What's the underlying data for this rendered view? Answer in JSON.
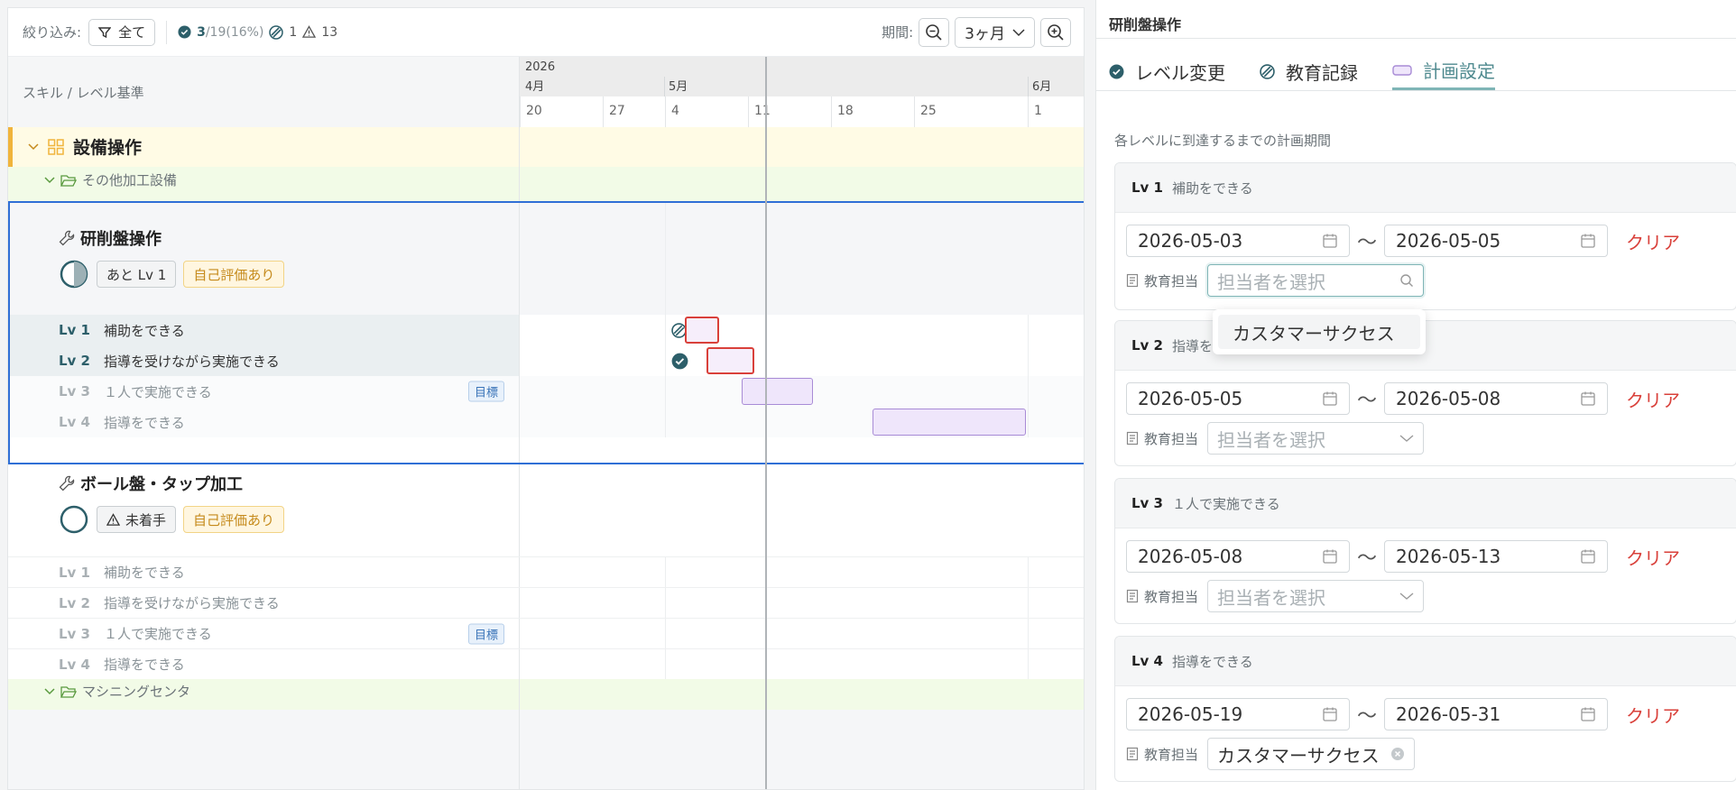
{
  "toolbar": {
    "filter_label": "絞り込み:",
    "filter_value": "全て",
    "stat_done": "3",
    "stat_total": "/19",
    "stat_pct": "(16%)",
    "stat_edu": "1",
    "stat_warn": "13",
    "period_label": "期間:",
    "period_value": "3ヶ月"
  },
  "timeline": {
    "column_header": "スキル / レベル基準",
    "year": "2026",
    "months": [
      "4月",
      "5月",
      "6月"
    ],
    "days": [
      "20",
      "27",
      "4",
      "11",
      "18",
      "25",
      "1"
    ]
  },
  "category": {
    "name": "設備操作"
  },
  "groups": [
    {
      "name": "その他加工設備"
    },
    {
      "name": "マシニングセンタ"
    }
  ],
  "skills": [
    {
      "name": "研削盤操作",
      "tag1": "あと Lv 1",
      "tag2": "自己評価あり",
      "levels": [
        {
          "lv": "Lv 1",
          "desc": "補助をできる"
        },
        {
          "lv": "Lv 2",
          "desc": "指導を受けながら実施できる"
        },
        {
          "lv": "Lv 3",
          "desc": "１人で実施できる",
          "goal": "目標"
        },
        {
          "lv": "Lv 4",
          "desc": "指導をできる"
        }
      ]
    },
    {
      "name": "ボール盤・タップ加工",
      "tag1": "未着手",
      "tag2": "自己評価あり",
      "levels": [
        {
          "lv": "Lv 1",
          "desc": "補助をできる"
        },
        {
          "lv": "Lv 2",
          "desc": "指導を受けながら実施できる"
        },
        {
          "lv": "Lv 3",
          "desc": "１人で実施できる",
          "goal": "目標"
        },
        {
          "lv": "Lv 4",
          "desc": "指導をできる"
        }
      ]
    }
  ],
  "panel": {
    "title": "研削盤操作",
    "tabs": [
      "レベル変更",
      "教育記録",
      "計画設定"
    ],
    "description": "各レベルに到達するまでの計画期間",
    "assign_label": "教育担当",
    "assign_placeholder": "担当者を選択",
    "clear_label": "クリア",
    "tilde": "〜",
    "cards": [
      {
        "lv": "Lv 1",
        "desc": "補助をできる",
        "start": "2026-05-03",
        "end": "2026-05-05"
      },
      {
        "lv": "Lv 2",
        "desc": "指導を",
        "start": "2026-05-05",
        "end": "2026-05-08"
      },
      {
        "lv": "Lv 3",
        "desc": "１人で実施できる",
        "start": "2026-05-08",
        "end": "2026-05-13"
      },
      {
        "lv": "Lv 4",
        "desc": "指導をできる",
        "start": "2026-05-19",
        "end": "2026-05-31",
        "assignee": "カスタマーサクセス"
      }
    ],
    "dropdown_option": "カスタマーサクセス"
  },
  "colors": {
    "accent": "#4f8a8f",
    "selection": "#2f6fd6",
    "danger": "#d9403a",
    "category": "#f0b43c"
  }
}
